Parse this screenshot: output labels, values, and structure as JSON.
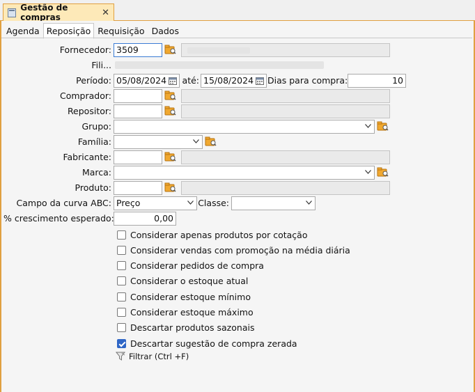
{
  "window": {
    "tab_title": "Gestão de compras",
    "close_glyph": "✕",
    "icon": "window-icon"
  },
  "tabs": [
    {
      "label": "Agenda",
      "active": false
    },
    {
      "label": "Reposição",
      "active": true
    },
    {
      "label": "Requisição",
      "active": false
    },
    {
      "label": "Dados",
      "active": false
    }
  ],
  "form": {
    "fornecedor": {
      "label": "Fornecedor:",
      "value": "3509"
    },
    "fili": {
      "label": "Fili..."
    },
    "periodo": {
      "label": "Período:",
      "start": "05/08/2024",
      "ate_label": "até:",
      "end": "15/08/2024"
    },
    "dias": {
      "label": "Dias para compra:",
      "value": "10"
    },
    "comprador": {
      "label": "Comprador:",
      "value": ""
    },
    "repositor": {
      "label": "Repositor:",
      "value": ""
    },
    "grupo": {
      "label": "Grupo:",
      "value": ""
    },
    "familia": {
      "label": "Família:",
      "value": ""
    },
    "fabricante": {
      "label": "Fabricante:",
      "value": ""
    },
    "marca": {
      "label": "Marca:",
      "value": ""
    },
    "produto": {
      "label": "Produto:",
      "value": ""
    },
    "curva": {
      "label": "Campo da curva ABC:",
      "value": "Preço"
    },
    "classe": {
      "label": "Classe:",
      "value": ""
    },
    "crescimento": {
      "label": "% crescimento esperado:",
      "value": "0,00"
    }
  },
  "checkboxes": [
    {
      "label": "Considerar apenas produtos por cotação",
      "checked": false
    },
    {
      "label": "Considerar vendas com promoção na média diária",
      "checked": false
    },
    {
      "label": "Considerar pedidos de compra",
      "checked": false
    },
    {
      "label": "Considerar o estoque atual",
      "checked": false
    },
    {
      "label": "Considerar estoque mínimo",
      "checked": false
    },
    {
      "label": "Considerar estoque máximo",
      "checked": false
    },
    {
      "label": "Descartar produtos sazonais",
      "checked": false
    },
    {
      "label": "Descartar sugestão de compra zerada",
      "checked": true
    }
  ],
  "filter": {
    "label": "Filtrar (Ctrl +F)",
    "icon": "funnel-icon"
  },
  "colors": {
    "accent": "#e0a040",
    "tab_bg": "#fde9b8",
    "checkbox_checked": "#2f66c6"
  }
}
